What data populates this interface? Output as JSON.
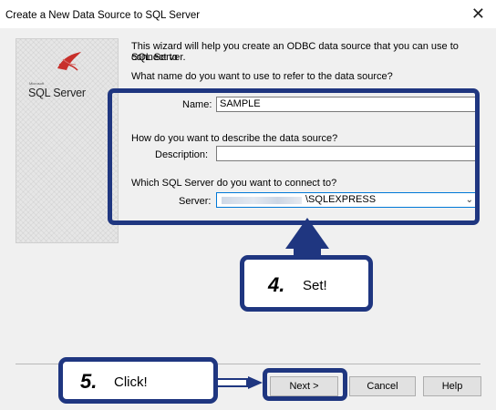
{
  "window": {
    "title": "Create a New Data Source to SQL Server",
    "close_glyph": "✕"
  },
  "sidebar": {
    "logo_small": "Microsoft",
    "logo_text": "SQL Server"
  },
  "intro": {
    "line1": "This wizard will help you create an ODBC data source that you can use to connect to",
    "line2": "SQL Server.",
    "question_name": "What name do you want to use to refer to the data source?"
  },
  "form": {
    "name_label": "Name:",
    "name_value": "SAMPLE",
    "question_description": "How do you want to describe the data source?",
    "description_label": "Description:",
    "description_value": "",
    "question_server": "Which SQL Server do you want to connect to?",
    "server_label": "Server:",
    "server_value": "\\SQLEXPRESS"
  },
  "callouts": {
    "step4_number": "4.",
    "step4_text": "Set!",
    "step5_number": "5.",
    "step5_text": "Click!"
  },
  "buttons": {
    "next": "Next >",
    "cancel": "Cancel",
    "help": "Help"
  },
  "colors": {
    "highlight": "#1f3680",
    "dialog_bg": "#f0f0f0"
  },
  "icons": {
    "close": "close-icon",
    "dropdown": "chevron-down-icon",
    "logo": "sql-server-logo-icon"
  }
}
